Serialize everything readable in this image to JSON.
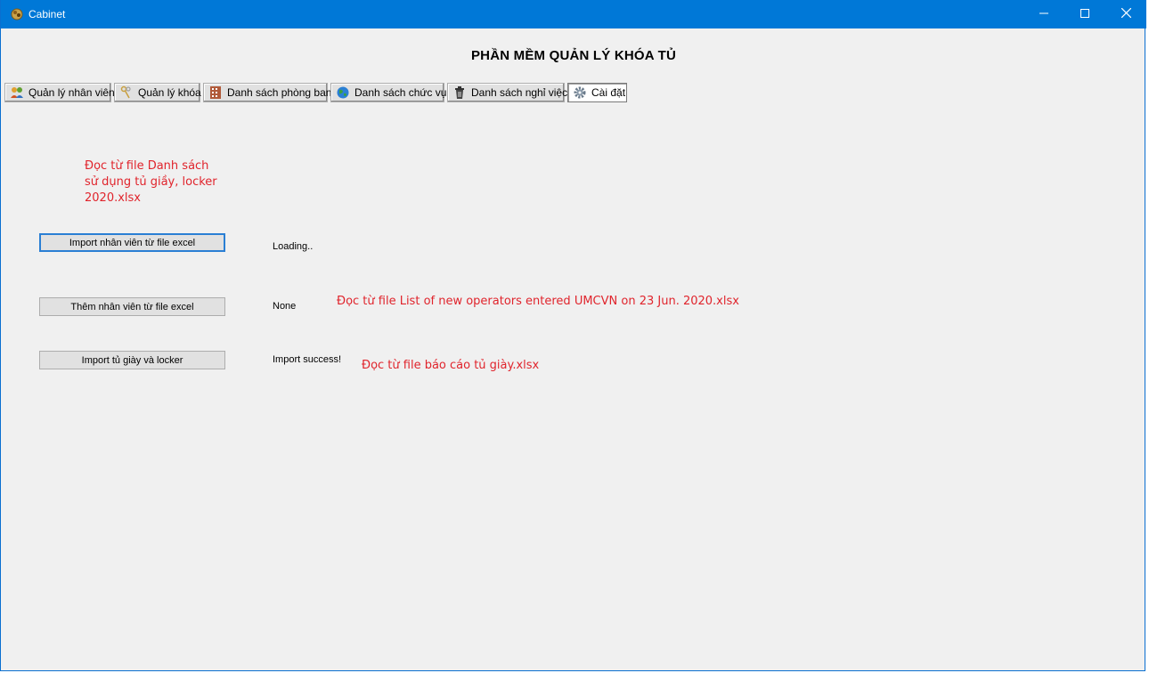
{
  "window": {
    "title": "Cabinet",
    "app_icon": "cabinet-app-icon",
    "controls": {
      "minimize": "minimize-icon",
      "maximize": "maximize-icon",
      "close": "close-icon"
    }
  },
  "heading": "PHẦN MỀM QUẢN LÝ KHÓA TỦ",
  "tabs": [
    {
      "label": "Quản lý nhân viên",
      "icon": "people-icon"
    },
    {
      "label": "Quản lý khóa",
      "icon": "keys-icon"
    },
    {
      "label": "Danh sách phòng ban",
      "icon": "building-icon"
    },
    {
      "label": "Danh sách chức vụ",
      "icon": "globe-icon"
    },
    {
      "label": "Danh sách nghỉ việc",
      "icon": "trash-icon"
    },
    {
      "label": "Cài đặt",
      "icon": "gear-icon",
      "selected": true
    }
  ],
  "notes": {
    "note1_line1": "Đọc từ file Danh sách",
    "note1_line2": "sử dụng tủ giầy, locker",
    "note1_line3": "2020.xlsx",
    "note2": "Đọc từ file List of new operators entered UMCVN on 23 Jun. 2020.xlsx",
    "note3": "Đọc từ file báo cáo tủ giày.xlsx"
  },
  "actions": [
    {
      "label": "Import nhân viên từ file excel",
      "status": "Loading.."
    },
    {
      "label": "Thêm nhân viên từ file excel",
      "status": "None"
    },
    {
      "label": "Import tủ giày và locker",
      "status": "Import success!"
    }
  ],
  "colors": {
    "titlebar": "#0078d7",
    "note": "#e0242c",
    "focus": "#2a7fd4"
  }
}
